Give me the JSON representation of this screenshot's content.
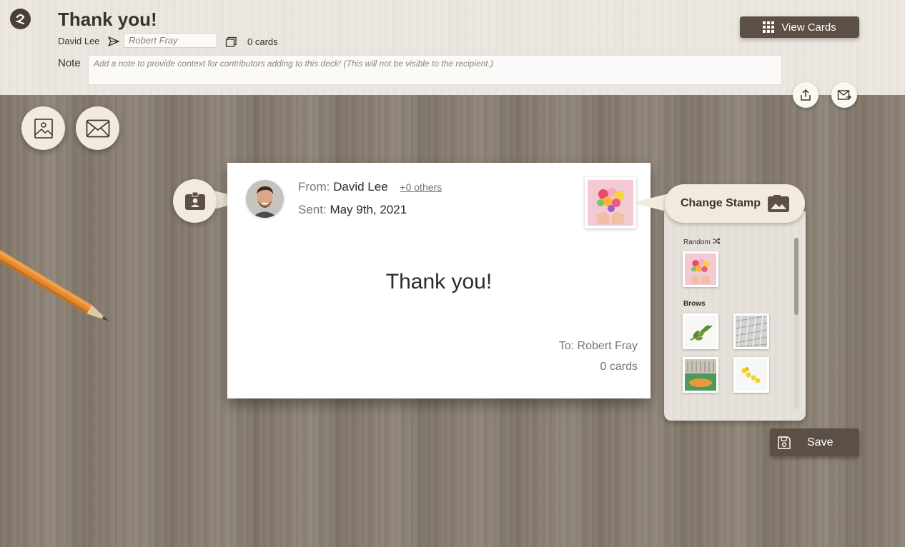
{
  "header": {
    "title": "Thank you!",
    "from_name": "David Lee",
    "recipient_value": "Robert Fray",
    "cards_count": "0 cards",
    "note_label": "Note",
    "note_placeholder": "Add a note to provide context for contributors adding to this deck! (This will not be visible to the recipient.)",
    "view_cards_label": "View Cards"
  },
  "card": {
    "from_label": "From:",
    "from_name": "David Lee",
    "others_link": "+0 others",
    "sent_label": "Sent:",
    "sent_date": "May 9th, 2021",
    "message": "Thank you!",
    "to_line": "To: Robert Fray",
    "cards_count": "0 cards"
  },
  "stamp_panel": {
    "change_label": "Change Stamp",
    "random_label": "Random",
    "category_label": "Brows"
  },
  "save_label": "Save",
  "colors": {
    "dark_button": "#5c4f45",
    "cream": "#f2ebdd",
    "wood": "#8a7f72",
    "header_bg": "#ebe6df"
  },
  "icons": {
    "logo": "logo-icon",
    "send": "send-arrow-icon",
    "cards": "cards-stack-icon",
    "grid": "grid-icon",
    "share": "share-icon",
    "email_send": "email-send-icon",
    "image": "image-icon",
    "envelope": "envelope-icon",
    "contact": "contact-card-icon",
    "photo": "photo-icon",
    "shuffle": "shuffle-icon",
    "save": "floppy-disk-icon"
  }
}
